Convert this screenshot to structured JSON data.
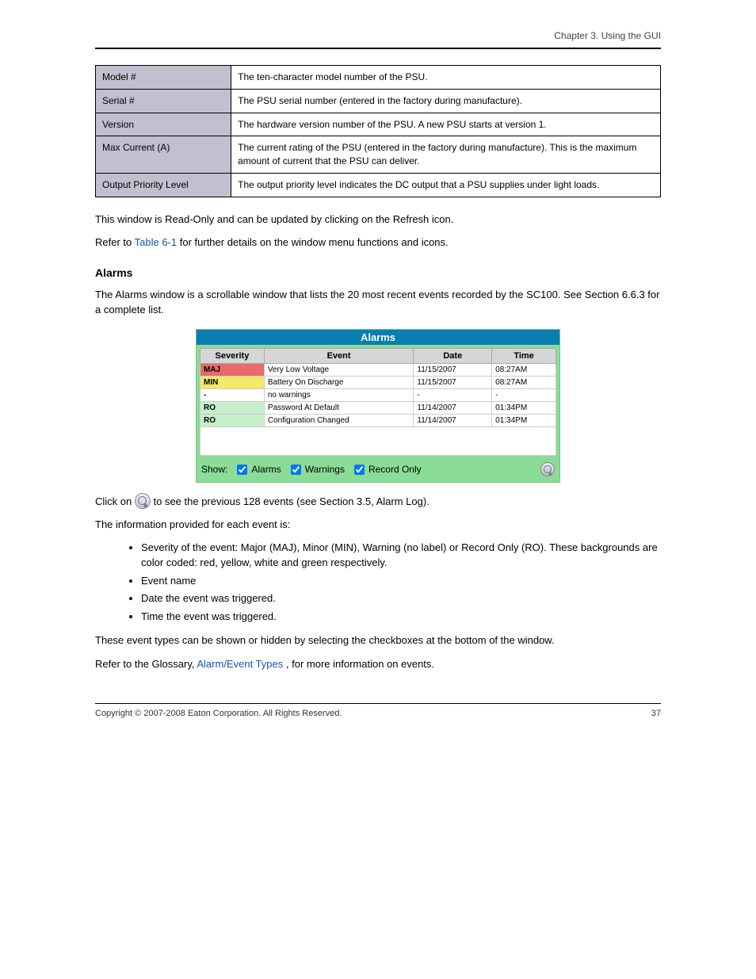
{
  "header": {
    "chapter_title": "Chapter 3. Using the GUI"
  },
  "info_rows": [
    {
      "field": "Model #",
      "desc": "The ten-character model number of the PSU."
    },
    {
      "field": "Serial #",
      "desc": "The PSU serial number (entered in the factory during manufacture)."
    },
    {
      "field": "Version",
      "desc": "The hardware version number of the PSU. A new PSU starts at version 1."
    },
    {
      "field": "Max Current (A)",
      "desc": "The current rating of the PSU (entered in the factory during manufacture). This is the maximum amount of current that the PSU can deliver."
    },
    {
      "field": "Output Priority Level",
      "desc": "The output priority level indicates the DC output that a PSU supplies under light loads."
    }
  ],
  "body": {
    "p1": "This window is Read-Only and can be updated by clicking on the Refresh icon.",
    "p2_prefix": "Refer to ",
    "p2_link": "Table 6-1",
    "p2_suffix": " for further details on the window menu functions and icons.",
    "h_alarms": "Alarms",
    "p3": "The Alarms window is a scrollable window that lists the 20 most recent events recorded by the SC100. See Section 6.6.3 for a complete list.",
    "p4_prefix": "Click on ",
    "p4_suffix": " to see the previous 128 events (see Section 3.5, Alarm Log)."
  },
  "alarms_panel": {
    "title": "Alarms",
    "columns": {
      "sev": "Severity",
      "evt": "Event",
      "date": "Date",
      "time": "Time"
    },
    "rows": [
      {
        "sev_code": "MAJ",
        "sev_class": "sev-maj",
        "event": "Very Low Voltage",
        "date": "11/15/2007",
        "time": "08:27AM"
      },
      {
        "sev_code": "MIN",
        "sev_class": "sev-min",
        "event": "Battery On Discharge",
        "date": "11/15/2007",
        "time": "08:27AM"
      },
      {
        "sev_code": "-",
        "sev_class": "sev-none",
        "event": "no warnings",
        "date": "-",
        "time": "-"
      },
      {
        "sev_code": "RO",
        "sev_class": "sev-ro",
        "event": "Password At Default",
        "date": "11/14/2007",
        "time": "01:34PM"
      },
      {
        "sev_code": "RO",
        "sev_class": "sev-ro",
        "event": "Configuration Changed",
        "date": "11/14/2007",
        "time": "01:34PM"
      }
    ],
    "footer": {
      "show_label": "Show:",
      "cb1": "Alarms",
      "cb2": "Warnings",
      "cb3": "Record Only"
    }
  },
  "explain": {
    "p_intro": "The information provided for each event is:",
    "bullets": [
      "Severity of the event: Major (MAJ), Minor (MIN), Warning (no label) or Record Only (RO). These backgrounds are color coded: red, yellow, white and green respectively.",
      "Event name",
      "Date the event was triggered.",
      "Time the event was triggered."
    ],
    "p_after": "These event types can be shown or hidden by selecting the checkboxes at the bottom of the window.",
    "p_glossary_prefix": "Refer to the Glossary, ",
    "p_glossary_link": "Alarm/Event Types",
    "p_glossary_suffix": ", for more information on events."
  },
  "footer": {
    "left": "Copyright © 2007-2008 Eaton Corporation. All Rights Reserved.",
    "right": "37"
  }
}
